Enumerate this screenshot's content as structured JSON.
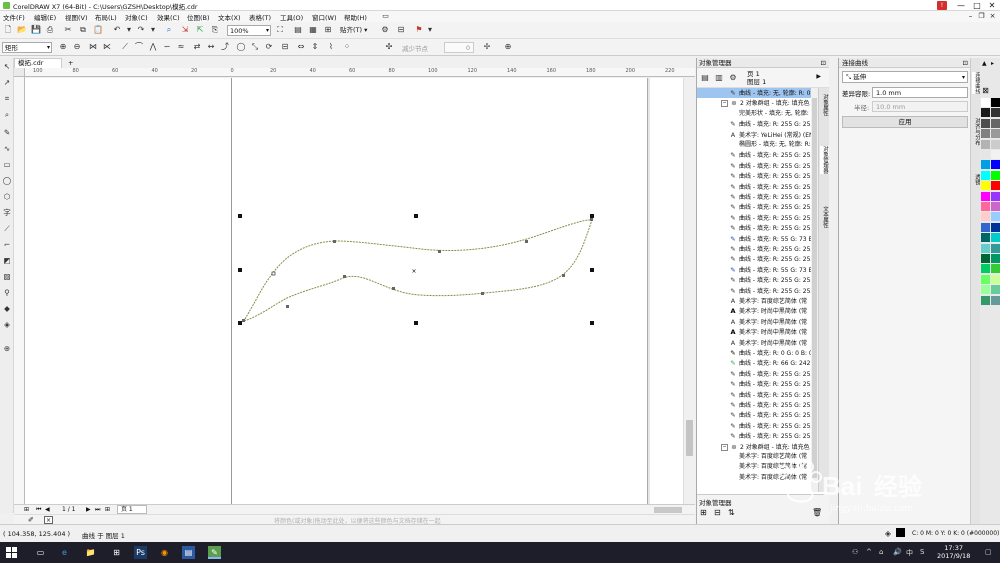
{
  "window": {
    "title": "CorelDRAW X7 (64-Bit) - C:\\Users\\GZSH\\Desktop\\模拓.cdr",
    "alert_label": "!",
    "minimize": "—",
    "maximize": "□",
    "close": "✕"
  },
  "menu": [
    "文件(F)",
    "编辑(E)",
    "视图(V)",
    "布局(L)",
    "对象(C)",
    "效果(C)",
    "位图(B)",
    "文本(X)",
    "表格(T)",
    "工具(O)",
    "窗口(W)",
    "帮助(H)"
  ],
  "toolbar": {
    "zoom": "100%",
    "snap_label": "贴齐(T)"
  },
  "property_bar": {
    "shape_select": "矩形",
    "reduce_nodes": "减少节点",
    "curve_smoothness": "0"
  },
  "document": {
    "tab_label": "模拓.cdr",
    "add_tab": "+"
  },
  "ruler": {
    "h_ticks": [
      "100",
      "80",
      "60",
      "40",
      "20",
      "0",
      "20",
      "40",
      "60",
      "80",
      "100",
      "120",
      "140",
      "160",
      "180",
      "200",
      "220"
    ]
  },
  "page_nav": {
    "page_counter": "1 / 1",
    "page_tab": "页 1"
  },
  "fill_hint": "将颜色(或对象)拖动至此处，以便将这些颜色与文档存储在一起",
  "status": {
    "coords": "( 104.358, 125.404 )",
    "status_text": "曲线 于 图层 1",
    "stroke_info": "C: 0 M: 0 Y: 0 K: 100  .200 mm",
    "fill_info": "C: 0 M: 0 Y: 0 K: 0 (#000000)"
  },
  "object_manager": {
    "title": "对象管理器",
    "page_label": "页 1",
    "layer_label": "图层 1",
    "rows": [
      {
        "icon": "curve",
        "label": "曲线 - 填充: 无, 轮廓: R: 0",
        "selected": true,
        "indent": 2
      },
      {
        "icon": "group",
        "label": "2 对象群组 - 填充: 填充色",
        "expander": true,
        "indent": 1
      },
      {
        "icon": "none",
        "label": "完美形状 - 填充: 无, 轮廓:",
        "indent": 2
      },
      {
        "icon": "curve",
        "label": "曲线 - 填充: R: 255 G: 255 B",
        "indent": 2
      },
      {
        "icon": "text",
        "label": "美术字: YeLiHei (常规) (EN",
        "indent": 2
      },
      {
        "icon": "none",
        "label": "椭圆形 - 填充: 无, 轮廓: R:",
        "indent": 2
      },
      {
        "icon": "curve",
        "label": "曲线 - 填充: R: 255 G: 255 B",
        "indent": 2
      },
      {
        "icon": "curve",
        "label": "曲线 - 填充: R: 255 G: 255 B",
        "indent": 2
      },
      {
        "icon": "curve",
        "label": "曲线 - 填充: R: 255 G: 255 B",
        "indent": 2
      },
      {
        "icon": "curve",
        "label": "曲线 - 填充: R: 255 G: 255 B",
        "indent": 2
      },
      {
        "icon": "curve",
        "label": "曲线 - 填充: R: 255 G: 255 B",
        "indent": 2
      },
      {
        "icon": "curve",
        "label": "曲线 - 填充: R: 255 G: 255 B",
        "indent": 2
      },
      {
        "icon": "curve",
        "label": "曲线 - 填充: R: 255 G: 255 B",
        "indent": 2
      },
      {
        "icon": "curve",
        "label": "曲线 - 填充: R: 255 G: 255 B",
        "indent": 2
      },
      {
        "icon": "curve-blue",
        "label": "曲线 - 填充: R: 55 G: 73 B: 2",
        "indent": 2
      },
      {
        "icon": "curve",
        "label": "曲线 - 填充: R: 255 G: 255 B",
        "indent": 2
      },
      {
        "icon": "curve",
        "label": "曲线 - 填充: R: 255 G: 255 B",
        "indent": 2
      },
      {
        "icon": "curve-blue",
        "label": "曲线 - 填充: R: 55 G: 73 B: 2",
        "indent": 2
      },
      {
        "icon": "curve",
        "label": "曲线 - 填充: R: 255 G: 255 B",
        "indent": 2
      },
      {
        "icon": "curve",
        "label": "曲线 - 填充: R: 255 G: 255 B",
        "indent": 2
      },
      {
        "icon": "text",
        "label": "美术字: 百度综艺简体 (常",
        "indent": 2
      },
      {
        "icon": "text-bold",
        "label": "美术字: 时尚中黑简体 (常",
        "indent": 2
      },
      {
        "icon": "text",
        "label": "美术字: 时尚中黑简体 (常",
        "indent": 2
      },
      {
        "icon": "text-bold",
        "label": "美术字: 时尚中黑简体 (常",
        "indent": 2
      },
      {
        "icon": "text",
        "label": "美术字: 时尚中黑简体 (常",
        "indent": 2
      },
      {
        "icon": "curve-black",
        "label": "曲线 - 填充: R: 0 G: 0 B: 0 (",
        "indent": 2
      },
      {
        "icon": "curve-green",
        "label": "曲线 - 填充: R: 66 G: 242 B:",
        "indent": 2
      },
      {
        "icon": "curve",
        "label": "曲线 - 填充: R: 255 G: 255 B",
        "indent": 2
      },
      {
        "icon": "curve",
        "label": "曲线 - 填充: R: 255 G: 255 B",
        "indent": 2
      },
      {
        "icon": "curve",
        "label": "曲线 - 填充: R: 255 G: 255 B",
        "indent": 2
      },
      {
        "icon": "curve",
        "label": "曲线 - 填充: R: 255 G: 255 B",
        "indent": 2
      },
      {
        "icon": "curve",
        "label": "曲线 - 填充: R: 255 G: 255 B",
        "indent": 2
      },
      {
        "icon": "curve",
        "label": "曲线 - 填充: R: 255 G: 255 B",
        "indent": 2
      },
      {
        "icon": "curve",
        "label": "曲线 - 填充: R: 255 G: 255 B",
        "indent": 2
      },
      {
        "icon": "group",
        "label": "2 对象群组 - 填充: 填充色",
        "expander": true,
        "indent": 1
      },
      {
        "icon": "none",
        "label": "美术字: 百度综艺简体 (常",
        "indent": 2
      },
      {
        "icon": "none",
        "label": "美术字: 百度综艺简体 (常",
        "indent": 2
      },
      {
        "icon": "none",
        "label": "美术字: 百度综艺简体 (常",
        "indent": 2
      }
    ],
    "bottom_label": "对象管理器",
    "side_tabs": [
      "对象属性",
      "对象管理器",
      "文本属性"
    ]
  },
  "connect_curve": {
    "title": "连接曲线",
    "mode": "延伸",
    "tolerance_label": "差异容限:",
    "tolerance_value": "1.0 mm",
    "radius_label": "半径:",
    "radius_value": "10.0 mm",
    "apply_label": "应用"
  },
  "dock_tabs": [
    "连接曲线",
    "对齐与分布",
    "透镜"
  ],
  "palette": {
    "colors": [
      "#ffffff",
      "#000000",
      "#1a1a1a",
      "#333333",
      "#4d4d4d",
      "#666666",
      "#808080",
      "#999999",
      "#b3b3b3",
      "#cccccc",
      "#e6e6e6",
      "#f2f2f2",
      "#00a0e9",
      "#0000ff",
      "#00ffff",
      "#00ff00",
      "#ffff00",
      "#ff0000",
      "#ff00ff",
      "#9933ff",
      "#ff6699",
      "#cc66cc",
      "#ffcccc",
      "#99ccff",
      "#3366cc",
      "#003399",
      "#006666",
      "#00cccc",
      "#66cccc",
      "#339999",
      "#006633",
      "#009966",
      "#00cc66",
      "#33cc33",
      "#66ff66",
      "#ccff99",
      "#99ff99",
      "#66cc99",
      "#339966",
      "#669999"
    ],
    "no_color": "⊠"
  },
  "taskbar": {
    "time": "17:37",
    "date": "2017/9/18"
  }
}
